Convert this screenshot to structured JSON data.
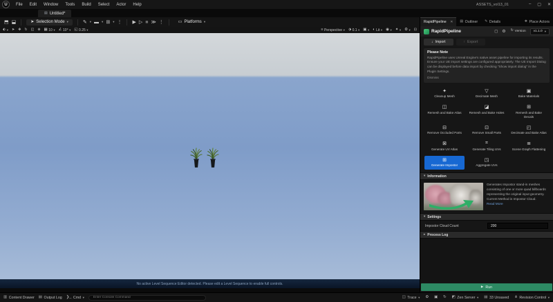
{
  "window": {
    "title": "ASSETS_vol13_01",
    "menus": [
      "File",
      "Edit",
      "Window",
      "Tools",
      "Build",
      "Select",
      "Actor",
      "Help"
    ],
    "level_tab": "Untitled*"
  },
  "toolbar": {
    "selection_mode": "Selection Mode",
    "platforms": "Platforms"
  },
  "viewport": {
    "perspective": "Perspective",
    "camera_speed": "0.1",
    "lit": "Lit",
    "snap_position": "10",
    "snap_rotation": "10°",
    "snap_scale": "0.25",
    "message": "No active Level Sequence Editor detected. Please edit a Level Sequence to enable full controls."
  },
  "right_panel": {
    "tabs": {
      "pipeline": "RapidPipeline",
      "outliner": "Outliner",
      "details": "Details",
      "place_actors": "Place Actors"
    },
    "header": {
      "title": "RapidPipeline",
      "version_label": "Version",
      "version": "v1.1.0"
    },
    "import_label": "Import",
    "export_label": "Export",
    "note": {
      "title": "Please Note",
      "body": "RapidPipeline uses Unreal Engine's native asset pipeline for importing its results. Ensure your UE import settings are configured appropriately. The UE Import Dialog can be displayed before data import by checking \"Show import dialog\" in the Plugin Settings.",
      "dismiss": "Dismiss"
    },
    "actions": [
      {
        "label": "Cleanup Mesh",
        "icon": "✦",
        "active": false
      },
      {
        "label": "Decimate Mesh",
        "icon": "▽",
        "active": false
      },
      {
        "label": "Bake Materials",
        "icon": "▣",
        "active": false
      },
      {
        "label": "Remesh and Bake Atlas",
        "icon": "◫",
        "active": false
      },
      {
        "label": "Remesh and Bake Holes",
        "icon": "◪",
        "active": false
      },
      {
        "label": "Remesh and Bake Decals",
        "icon": "⊞",
        "active": false
      },
      {
        "label": "Remove Occluded Parts",
        "icon": "⊟",
        "active": false
      },
      {
        "label": "Remove Small Parts",
        "icon": "⊡",
        "active": false
      },
      {
        "label": "Decimate and Bake Atlas",
        "icon": "◰",
        "active": false
      },
      {
        "label": "Generate UV Atlas",
        "icon": "⊠",
        "active": false
      },
      {
        "label": "Generate Tiling UVs",
        "icon": "⌗",
        "active": false
      },
      {
        "label": "Scene Graph Flattening",
        "icon": "≣",
        "active": false
      },
      {
        "label": "Generate Impostor",
        "icon": "⊞",
        "active": true
      },
      {
        "label": "Aggregate UVs",
        "icon": "◳",
        "active": false
      }
    ],
    "information": {
      "header": "Information",
      "body": "Generates Impostor stand-in meshes consisting of one or more quad billboards representing the original input geometry. Current Method is Impostor Cloud.",
      "read_more": "Read More"
    },
    "settings": {
      "header": "Settings",
      "cloud_count_label": "Impostor Cloud Count",
      "cloud_count_value": "200"
    },
    "process_log_header": "Process Log",
    "run_label": "Run"
  },
  "status_bar": {
    "content_drawer": "Content Drawer",
    "output_log": "Output Log",
    "cmd": "Cmd",
    "console_placeholder": "Enter Console Command",
    "trace": "Trace",
    "zen_server": "Zen Server",
    "unsaved": "33 Unsaved",
    "revision_control": "Revision Control"
  },
  "colors": {
    "accent_blue": "#1768d2",
    "run_green": "#2d8a63"
  },
  "icons": {
    "logo_u": "U",
    "minimize": "–",
    "restore": "▢",
    "close": "✕",
    "level": "▤",
    "save": "⬒",
    "content": "⬓",
    "cursor": "➤",
    "chev": "▾",
    "kebab": "⋮",
    "blueprint": "✎",
    "cinematics": "▬",
    "quick_add": "⊞",
    "play": "▶",
    "frame": "▷",
    "stop": "■",
    "next": "≫",
    "platforms": "▭",
    "tool": "⬖",
    "move": "✥",
    "rotate": "↻",
    "scale": "◱",
    "globe": "⊕",
    "grid": "▦",
    "angle": "∠",
    "hamburger": "≡",
    "camspeed": "⬗",
    "screenshot": "▣",
    "lit": "◐",
    "eye": "◉",
    "fx": "✦",
    "gear": "⚙",
    "max": "⊡",
    "lock": "◻",
    "import": "↓",
    "export": "↑",
    "collapse": "▾",
    "expand": "▸",
    "tab_outliner": "▤",
    "tab_details": "✎",
    "tab_place": "❖",
    "drawer": "▥",
    "outlog": "▤",
    "cmd": "❯_",
    "trace": "◫",
    "zen": "◩",
    "unsaved_icon": "▤",
    "revision": "⋔",
    "run": "▶"
  }
}
